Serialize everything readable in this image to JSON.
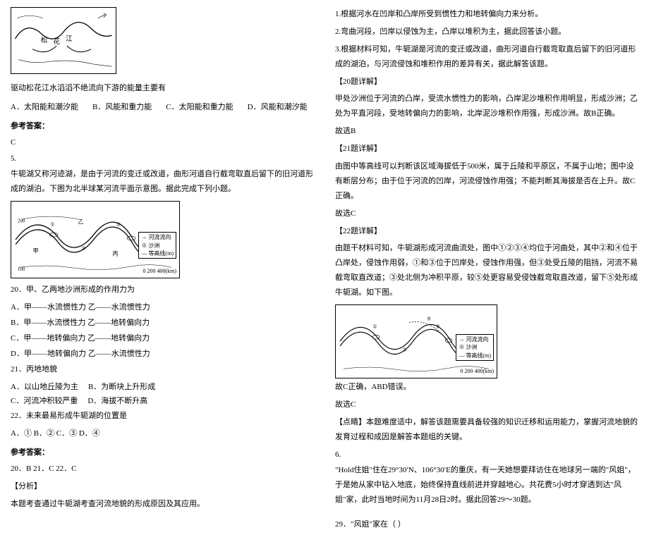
{
  "left": {
    "q_energy": "驱动松花江水滔滔不绝流向下游的能量主要有",
    "optA": "A．太阳能和潮汐能",
    "optB": "B．风能和重力能",
    "optC": "C．太阳能和重力能",
    "optD": "D．风能和潮汐能",
    "ref_label": "参考答案：",
    "ans1": "C",
    "num5": "5.",
    "oxbow_intro": "牛轭湖又称河迹湖，是由于河流的变迁或改道，曲形河道自行截弯取直后留下的旧河道形成的湖泊。下图为北半球某河流平面示意图。据此完成下列小题。",
    "legend1a": "→ 河流流向",
    "legend1b": "※ 沙洲",
    "legend1c": "— 等高线(m)",
    "scale1": "0    200    400(km)",
    "q20": "20．甲、乙两地沙洲形成的作用力为",
    "q20A": "A．甲——水流惯性力   乙——水流惯性力",
    "q20B": "B．甲——水流惯性力   乙——地转偏向力",
    "q20C": "C．甲——地转偏向力   乙——地转偏向力",
    "q20D": "D．甲——地转偏向力   乙——水流惯性力",
    "q21": "21．丙地地貌",
    "q21A": "A．以山地丘陵为主",
    "q21B": "B．为断块上升形成",
    "q21C": "C．河流冲积较严重",
    "q21D": "D．海拔不断升高",
    "q22": "22．未来最易形成牛轭湖的位置是",
    "q22opts": "A．①   B．②   C．③   D．④",
    "ref_label2": "参考答案：",
    "ans2": "20．B    21．C    22．C",
    "analysis_label": "【分析】",
    "analysis_text": "本题考查通过牛轭湖考查河流地貌的形成原因及其应用。"
  },
  "right": {
    "p1": "1.根据河水在凹岸和凸岸所受到惯性力和地转偏向力来分析。",
    "p2": "2.弯曲河段，凹岸以侵蚀为主，凸岸以堆积为主，据此回答该小题。",
    "p3": "3.根据材料可知，牛轭湖是河流的变迁或改道，曲形河道自行截弯取直后留下的旧河道形成的湖泊，与河流侵蚀和堆积作用的差异有关，据此解答该题。",
    "h20": "【20题详解】",
    "d20": "甲处沙洲位于河流的凸岸，受流水惯性力的影响，凸岸泥沙堆积作用明显，形成沙洲；乙处为平直河段，受地转偏向力的影响，北岸泥沙堆积作用强，形成沙洲。故B正确。",
    "sel20": "故选B",
    "h21": "【21题详解】",
    "d21": "由图中等高线可以判断该区域海拔低于500米，属于丘陵和平原区，不属于山地；图中没有断层分布；由于位于河流的凹岸，河流侵蚀作用强；不能判断其海拔是否在上升。故C正确。",
    "sel21": "故选C",
    "h22": "【22题详解】",
    "d22": "由题干材料可知，牛轭湖形成河流曲流处，图中①②③④均位于河曲处，其中②和④位于凸岸处，侵蚀作用弱，①和③位于凹岸处，侵蚀作用强，但③处受丘陵的阻挡，河流不易截弯取直改道；③处北侧为冲积平原，较⑤处更容易受侵蚀截弯取直改道，留下⑤处形成牛轭湖。如下图。",
    "legend2a": "→ 河流流向",
    "legend2b": "※ 沙洲",
    "legend2c": "— 等高线(m)",
    "scale2": "0    200    400(km)",
    "res22a": "故C正确，ABD错误。",
    "res22b": "故选C",
    "tips_h": "【点睛】本题难度适中，解答该题需要具备较强的知识迁移和运用能力，掌握河流地貌的发育过程和成因是解答本题组的关键。",
    "num6": "6.",
    "hold_text": "\"Hold住姐\"住在29°30′N、106°30′E的重庆，有一天她想要拜访住在地球另一端的\"风姐\"，于是她从家中钻入地底，始终保持直线前进并穿越地心。共花费5小时才穿透到达\"风姐\"家，此时当地时间为11月28日2时。据此回答29～30题。",
    "q29": "29．\"风姐\"家在（     ）"
  }
}
